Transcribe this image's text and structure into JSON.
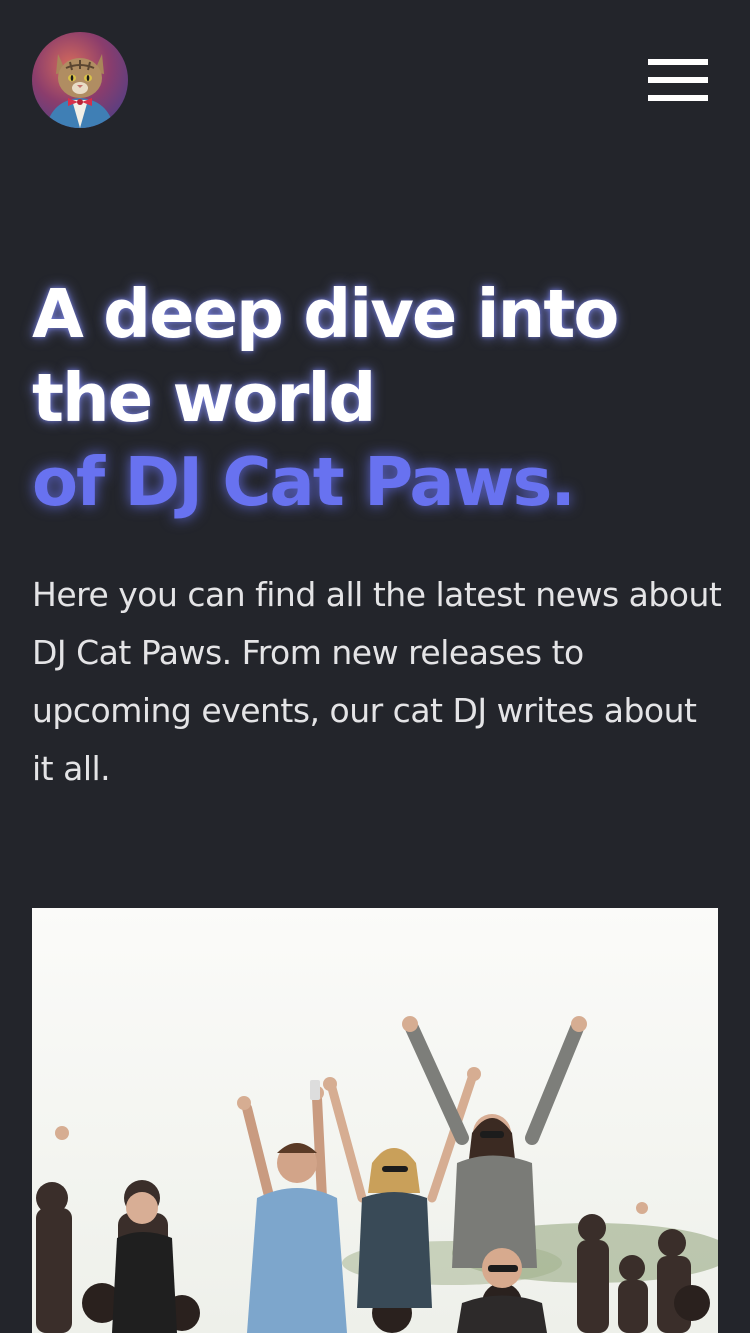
{
  "header": {
    "logo_icon": "cat-dj-avatar-icon",
    "menu_icon": "hamburger-menu-icon"
  },
  "hero": {
    "title_line1": "A deep dive into",
    "title_line2": "the world",
    "title_accent": "of DJ Cat Paws.",
    "intro": "Here you can find all the latest news about DJ Cat Paws. From new releases to upcoming events, our cat DJ writes about it all."
  },
  "colors": {
    "background": "#23252b",
    "accent": "#6872f0",
    "text": "#ffffff"
  },
  "image": {
    "subject": "crowd-photo"
  }
}
